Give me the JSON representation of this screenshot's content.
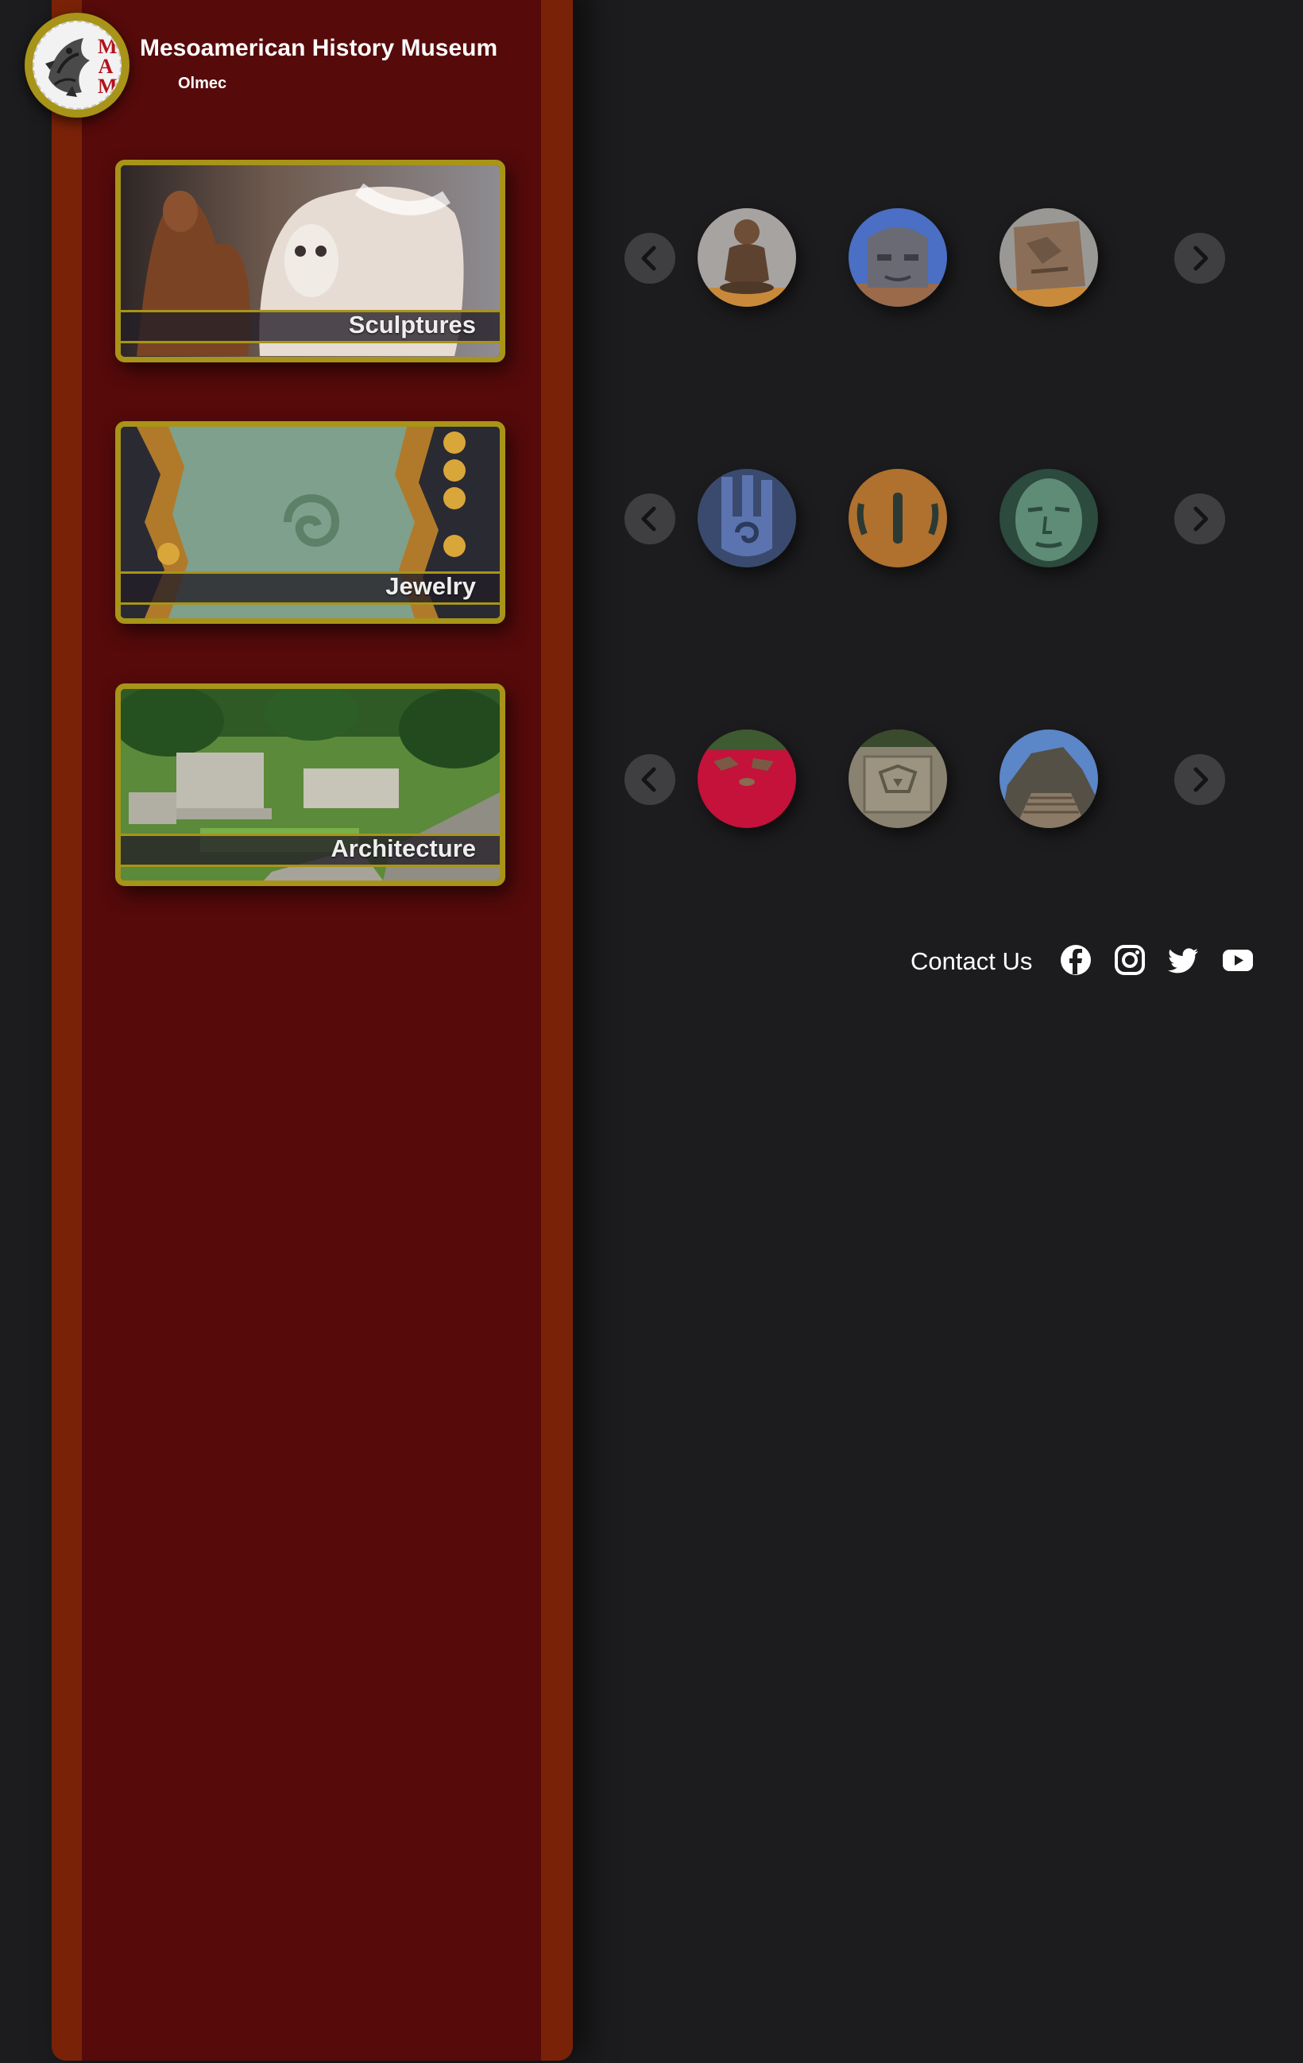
{
  "site": {
    "title": "Mesoamerican History Museum",
    "subtitle": "Olmec",
    "logo_letters": [
      "M",
      "A",
      "M"
    ]
  },
  "categories": [
    {
      "label": "Sculptures"
    },
    {
      "label": "Jewelry"
    },
    {
      "label": "Architecture"
    }
  ],
  "carousels": [
    {
      "thumbnails": [
        "seated-figure-sculpture",
        "colossal-head-sculpture",
        "carved-relief-sculpture"
      ]
    },
    {
      "thumbnails": [
        "jade-hand-jewelry",
        "ear-spool-jewelry",
        "jade-mask-jewelry"
      ]
    },
    {
      "thumbnails": [
        "red-site-architecture",
        "carved-stone-architecture",
        "pyramid-architecture"
      ]
    }
  ],
  "footer": {
    "contact_label": "Contact Us",
    "social": [
      "facebook-icon",
      "instagram-icon",
      "twitter-icon",
      "youtube-icon"
    ]
  },
  "colors": {
    "page_background": "#1c1c1e",
    "sidebar_outer": "#7a2208",
    "sidebar_inner": "#560a0a",
    "gold_accent": "#a89418",
    "nav_button": "#3f3f42"
  }
}
